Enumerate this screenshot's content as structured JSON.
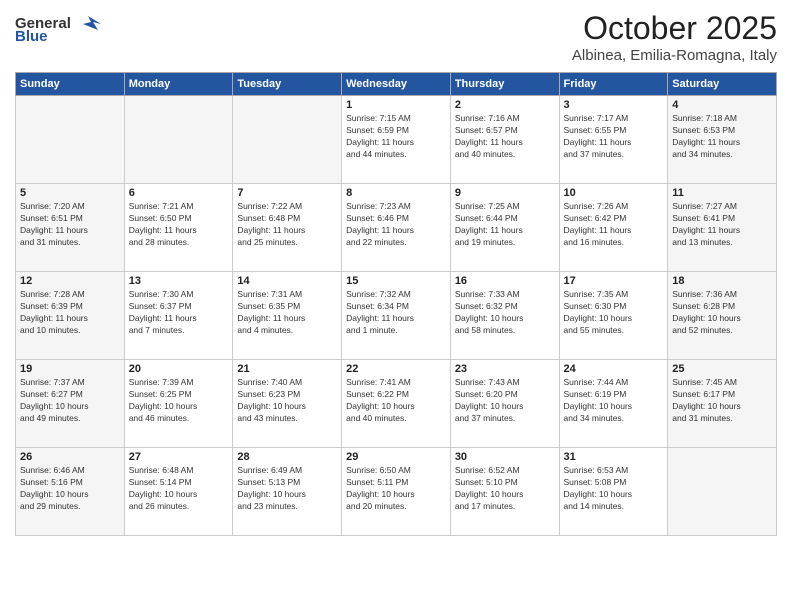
{
  "logo": {
    "general": "General",
    "blue": "Blue"
  },
  "title": "October 2025",
  "location": "Albinea, Emilia-Romagna, Italy",
  "days_of_week": [
    "Sunday",
    "Monday",
    "Tuesday",
    "Wednesday",
    "Thursday",
    "Friday",
    "Saturday"
  ],
  "weeks": [
    [
      {
        "day": "",
        "info": ""
      },
      {
        "day": "",
        "info": ""
      },
      {
        "day": "",
        "info": ""
      },
      {
        "day": "1",
        "info": "Sunrise: 7:15 AM\nSunset: 6:59 PM\nDaylight: 11 hours\nand 44 minutes."
      },
      {
        "day": "2",
        "info": "Sunrise: 7:16 AM\nSunset: 6:57 PM\nDaylight: 11 hours\nand 40 minutes."
      },
      {
        "day": "3",
        "info": "Sunrise: 7:17 AM\nSunset: 6:55 PM\nDaylight: 11 hours\nand 37 minutes."
      },
      {
        "day": "4",
        "info": "Sunrise: 7:18 AM\nSunset: 6:53 PM\nDaylight: 11 hours\nand 34 minutes."
      }
    ],
    [
      {
        "day": "5",
        "info": "Sunrise: 7:20 AM\nSunset: 6:51 PM\nDaylight: 11 hours\nand 31 minutes."
      },
      {
        "day": "6",
        "info": "Sunrise: 7:21 AM\nSunset: 6:50 PM\nDaylight: 11 hours\nand 28 minutes."
      },
      {
        "day": "7",
        "info": "Sunrise: 7:22 AM\nSunset: 6:48 PM\nDaylight: 11 hours\nand 25 minutes."
      },
      {
        "day": "8",
        "info": "Sunrise: 7:23 AM\nSunset: 6:46 PM\nDaylight: 11 hours\nand 22 minutes."
      },
      {
        "day": "9",
        "info": "Sunrise: 7:25 AM\nSunset: 6:44 PM\nDaylight: 11 hours\nand 19 minutes."
      },
      {
        "day": "10",
        "info": "Sunrise: 7:26 AM\nSunset: 6:42 PM\nDaylight: 11 hours\nand 16 minutes."
      },
      {
        "day": "11",
        "info": "Sunrise: 7:27 AM\nSunset: 6:41 PM\nDaylight: 11 hours\nand 13 minutes."
      }
    ],
    [
      {
        "day": "12",
        "info": "Sunrise: 7:28 AM\nSunset: 6:39 PM\nDaylight: 11 hours\nand 10 minutes."
      },
      {
        "day": "13",
        "info": "Sunrise: 7:30 AM\nSunset: 6:37 PM\nDaylight: 11 hours\nand 7 minutes."
      },
      {
        "day": "14",
        "info": "Sunrise: 7:31 AM\nSunset: 6:35 PM\nDaylight: 11 hours\nand 4 minutes."
      },
      {
        "day": "15",
        "info": "Sunrise: 7:32 AM\nSunset: 6:34 PM\nDaylight: 11 hours\nand 1 minute."
      },
      {
        "day": "16",
        "info": "Sunrise: 7:33 AM\nSunset: 6:32 PM\nDaylight: 10 hours\nand 58 minutes."
      },
      {
        "day": "17",
        "info": "Sunrise: 7:35 AM\nSunset: 6:30 PM\nDaylight: 10 hours\nand 55 minutes."
      },
      {
        "day": "18",
        "info": "Sunrise: 7:36 AM\nSunset: 6:28 PM\nDaylight: 10 hours\nand 52 minutes."
      }
    ],
    [
      {
        "day": "19",
        "info": "Sunrise: 7:37 AM\nSunset: 6:27 PM\nDaylight: 10 hours\nand 49 minutes."
      },
      {
        "day": "20",
        "info": "Sunrise: 7:39 AM\nSunset: 6:25 PM\nDaylight: 10 hours\nand 46 minutes."
      },
      {
        "day": "21",
        "info": "Sunrise: 7:40 AM\nSunset: 6:23 PM\nDaylight: 10 hours\nand 43 minutes."
      },
      {
        "day": "22",
        "info": "Sunrise: 7:41 AM\nSunset: 6:22 PM\nDaylight: 10 hours\nand 40 minutes."
      },
      {
        "day": "23",
        "info": "Sunrise: 7:43 AM\nSunset: 6:20 PM\nDaylight: 10 hours\nand 37 minutes."
      },
      {
        "day": "24",
        "info": "Sunrise: 7:44 AM\nSunset: 6:19 PM\nDaylight: 10 hours\nand 34 minutes."
      },
      {
        "day": "25",
        "info": "Sunrise: 7:45 AM\nSunset: 6:17 PM\nDaylight: 10 hours\nand 31 minutes."
      }
    ],
    [
      {
        "day": "26",
        "info": "Sunrise: 6:46 AM\nSunset: 5:16 PM\nDaylight: 10 hours\nand 29 minutes."
      },
      {
        "day": "27",
        "info": "Sunrise: 6:48 AM\nSunset: 5:14 PM\nDaylight: 10 hours\nand 26 minutes."
      },
      {
        "day": "28",
        "info": "Sunrise: 6:49 AM\nSunset: 5:13 PM\nDaylight: 10 hours\nand 23 minutes."
      },
      {
        "day": "29",
        "info": "Sunrise: 6:50 AM\nSunset: 5:11 PM\nDaylight: 10 hours\nand 20 minutes."
      },
      {
        "day": "30",
        "info": "Sunrise: 6:52 AM\nSunset: 5:10 PM\nDaylight: 10 hours\nand 17 minutes."
      },
      {
        "day": "31",
        "info": "Sunrise: 6:53 AM\nSunset: 5:08 PM\nDaylight: 10 hours\nand 14 minutes."
      },
      {
        "day": "",
        "info": ""
      }
    ]
  ]
}
